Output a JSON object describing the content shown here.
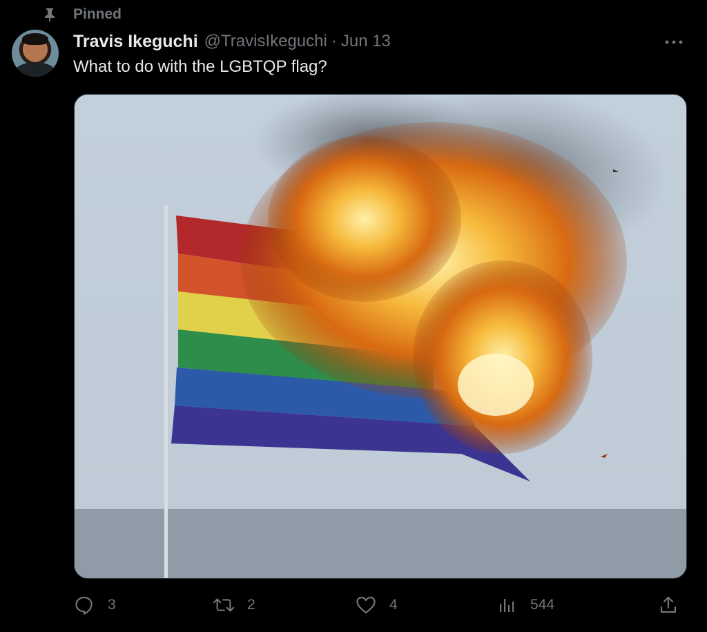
{
  "pinned": {
    "label": "Pinned",
    "icon": "pin-icon"
  },
  "tweet": {
    "author": {
      "display_name": "Travis Ikeguchi",
      "handle": "@TravisIkeguchi"
    },
    "separator": "·",
    "timestamp": "Jun 13",
    "text": "What to do with the LGBTQP flag?",
    "media": {
      "description_icon": "burning-rainbow-flag-photo"
    },
    "more_icon": "more-dots-icon"
  },
  "actions": {
    "reply": {
      "icon": "reply-icon",
      "count": "3"
    },
    "retweet": {
      "icon": "retweet-icon",
      "count": "2"
    },
    "like": {
      "icon": "heart-icon",
      "count": "4"
    },
    "views": {
      "icon": "analytics-icon",
      "count": "544"
    },
    "share": {
      "icon": "share-icon"
    }
  },
  "colors": {
    "background": "#000000",
    "primary_text": "#e7e9ea",
    "secondary_text": "#71767b",
    "border": "#2f3336"
  }
}
